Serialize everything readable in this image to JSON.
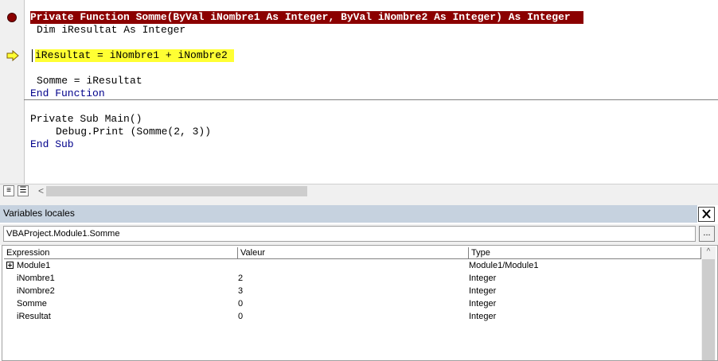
{
  "code": {
    "lines": [
      "Private Function Somme(ByVal iNombre1 As Integer, ByVal iNombre2 As Integer) As Integer",
      "Dim iResultat As Integer",
      "iResultat = iNombre1 + iNombre2",
      "Somme = iResultat",
      "End Function",
      "Private Sub Main()",
      "Debug.Print (Somme(2, 3))",
      "End Sub"
    ]
  },
  "editor": {
    "breakpoint_icon": "breakpoint-dot-icon",
    "current_line_icon": "execution-arrow-icon",
    "scroll_left": "<"
  },
  "panel": {
    "title": "Variables locales",
    "close": "✕",
    "context": "VBAProject.Module1.Somme",
    "context_button": "...",
    "columns": [
      "Expression",
      "Valeur",
      "Type"
    ],
    "rows": [
      {
        "expression": "Module1",
        "value": "",
        "type": "Module1/Module1"
      },
      {
        "expression": "iNombre1",
        "value": "2",
        "type": "Integer"
      },
      {
        "expression": "iNombre2",
        "value": "3",
        "type": "Integer"
      },
      {
        "expression": "Somme",
        "value": "0",
        "type": "Integer"
      },
      {
        "expression": "iResultat",
        "value": "0",
        "type": "Integer"
      }
    ],
    "scroll_up": "^"
  },
  "colors": {
    "breakpoint_line": "#8b0000",
    "current_line": "#ffff33",
    "keyword": "#00008b"
  }
}
